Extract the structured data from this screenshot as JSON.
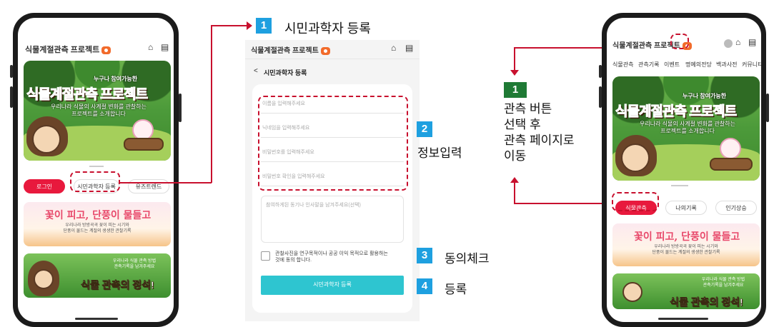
{
  "app": {
    "title": "식물계절관측 프로젝트"
  },
  "hero": {
    "small": "누구나 참여가능한",
    "big": "식물계절관측 프로젝트",
    "desc_line1": "우리나라 식물의 사계절 변화를 관찰하는",
    "desc_line2": "프로젝트를 소개합니다"
  },
  "left_phone": {
    "buttons": [
      "로그인",
      "시민과학자 등록",
      "유즈트렌드"
    ],
    "banner1": {
      "title": "꽃이 피고, 단풍이 물들고",
      "desc1": "우리나라 방방곡곡 꽃이 피는 시기와",
      "desc2": "단풍이 물드는 계절의 생생한 관찰기록"
    },
    "banner2": {
      "title": "식물 관측의 정석!",
      "desc1": "우리나라 식물 관측 방법",
      "desc2": "관측기록을 남겨주세요"
    }
  },
  "steps": {
    "s1": {
      "num": "1",
      "label": "시민과학자 등록"
    },
    "s2": {
      "num": "2",
      "label": "정보입력"
    },
    "s3": {
      "num": "3",
      "label": "동의체크"
    },
    "s4": {
      "num": "4",
      "label": "등록"
    }
  },
  "form": {
    "back": "<",
    "title": "시민과학자 등록",
    "name_placeholder": "이름을 입력해주세요",
    "nick_placeholder": "닉네임을 입력해주세요",
    "pw_placeholder": "비밀번호를 입력해주세요",
    "pw2_placeholder": "비밀번호 확인을 입력해주세요",
    "motive_placeholder": "참여하게된 동기나 인사말을 남겨주세요(선택)",
    "agree_line1": "관찰사진을 연구목적이나 공공 이익 목적으로 활용하는",
    "agree_line2": "것에 동의 합니다.",
    "submit": "시민과학자 등록"
  },
  "right_note": {
    "num": "1",
    "line1": "관측 버튼",
    "line2": "선택 후",
    "line3": "관측 페이지로",
    "line4": "이동"
  },
  "right_phone": {
    "menu": [
      "식물관측",
      "관측기록",
      "이벤트",
      "명예의전당",
      "백과사전",
      "커뮤니티"
    ],
    "buttons": [
      "식물관측",
      "나의기록",
      "인기상승"
    ]
  },
  "colors": {
    "accent_red": "#c8102e",
    "brand_orange": "#f26b2b",
    "step_blue": "#1ea0e0",
    "step_green": "#1f7a35",
    "submit_teal": "#2ec5d0"
  }
}
